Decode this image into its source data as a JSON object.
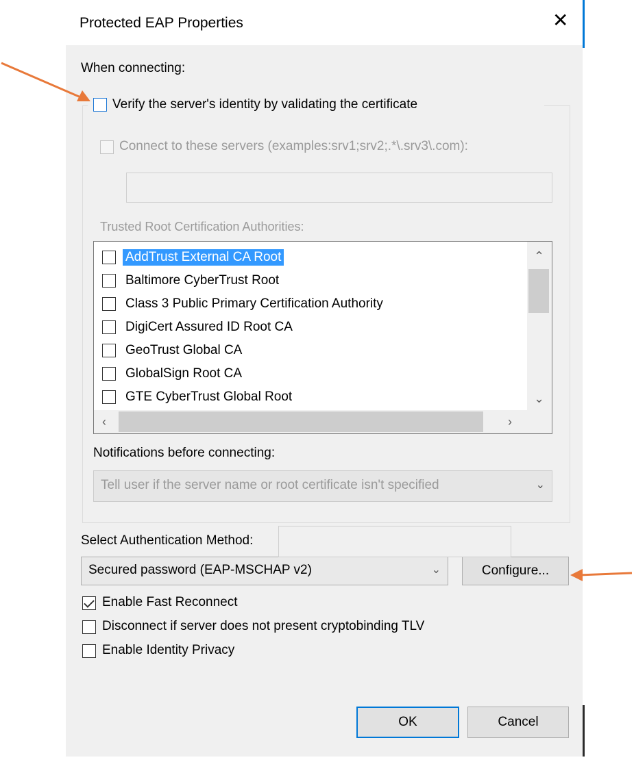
{
  "dialog": {
    "title": "Protected EAP Properties",
    "close_icon": "close-icon"
  },
  "connecting": {
    "heading": "When connecting:",
    "verify_label": "Verify the server's identity by validating the certificate",
    "verify_checked": false,
    "connect_servers_label": "Connect to these servers (examples:srv1;srv2;.*\\.srv3\\.com):",
    "connect_servers_value": "",
    "trusted_root_label": "Trusted Root Certification Authorities:",
    "cert_authorities": [
      {
        "name": "AddTrust External CA Root",
        "checked": false,
        "selected": true
      },
      {
        "name": "Baltimore CyberTrust Root",
        "checked": false,
        "selected": false
      },
      {
        "name": "Class 3 Public Primary Certification Authority",
        "checked": false,
        "selected": false
      },
      {
        "name": "DigiCert Assured ID Root CA",
        "checked": false,
        "selected": false
      },
      {
        "name": "GeoTrust Global CA",
        "checked": false,
        "selected": false
      },
      {
        "name": "GlobalSign Root CA",
        "checked": false,
        "selected": false
      },
      {
        "name": "GTE CyberTrust Global Root",
        "checked": false,
        "selected": false
      }
    ],
    "notifications_label": "Notifications before connecting:",
    "notifications_value": "Tell user if the server name or root certificate isn't specified"
  },
  "auth": {
    "heading": "Select Authentication Method:",
    "method_value": "Secured password (EAP-MSCHAP v2)",
    "configure_label": "Configure...",
    "fast_reconnect_label": "Enable Fast Reconnect",
    "fast_reconnect_checked": true,
    "cryptobinding_label": "Disconnect if server does not present cryptobinding TLV",
    "cryptobinding_checked": false,
    "identity_privacy_label": "Enable Identity Privacy",
    "identity_privacy_checked": false,
    "identity_value": ""
  },
  "footer": {
    "ok_label": "OK",
    "cancel_label": "Cancel"
  },
  "colors": {
    "annotation_arrow": "#e8793a",
    "selection": "#3399ff",
    "focus_border": "#0078d7"
  }
}
